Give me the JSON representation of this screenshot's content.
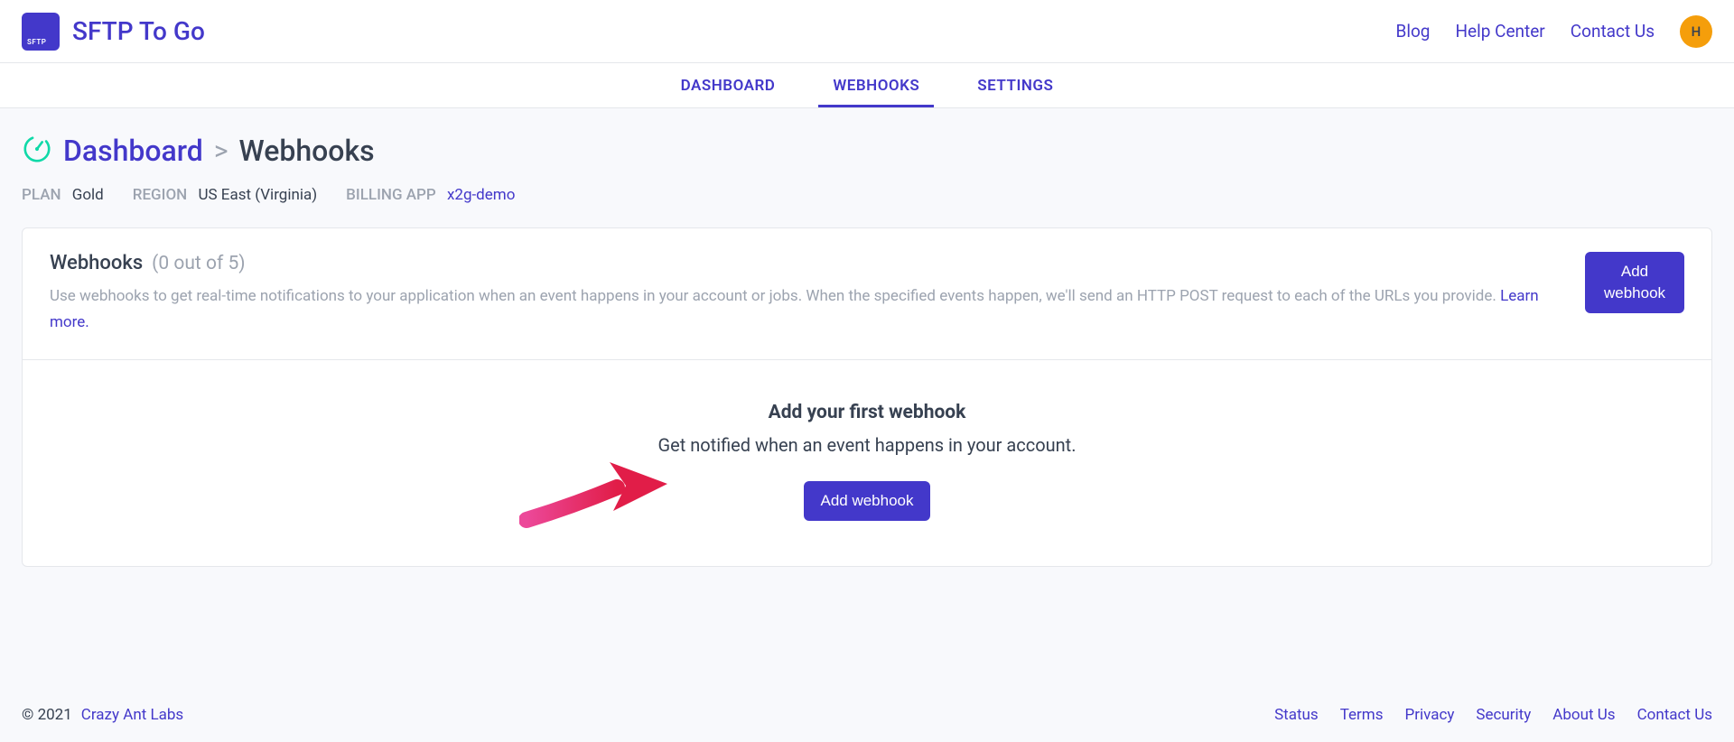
{
  "brand": {
    "name": "SFTP To Go",
    "logo_text": "SFTP"
  },
  "header": {
    "links": [
      "Blog",
      "Help Center",
      "Contact Us"
    ],
    "avatar_letter": "H"
  },
  "tabs": [
    "DASHBOARD",
    "WEBHOOKS",
    "SETTINGS"
  ],
  "breadcrumb": {
    "root": "Dashboard",
    "sep": ">",
    "current": "Webhooks"
  },
  "meta": {
    "plan_label": "PLAN",
    "plan_value": "Gold",
    "region_label": "REGION",
    "region_value": "US East (Virginia)",
    "billing_label": "BILLING APP",
    "billing_value": "x2g-demo"
  },
  "card": {
    "title": "Webhooks",
    "count": "(0 out of 5)",
    "desc": "Use webhooks to get real-time notifications to your application when an event happens in your account or jobs. When the specified events happen, we'll send an HTTP POST request to each of the URLs you provide.  ",
    "learn_more": "Learn more.",
    "add_btn": "Add webhook"
  },
  "empty": {
    "title": "Add your first webhook",
    "sub": "Get notified when an event happens in your account.",
    "btn": "Add webhook"
  },
  "footer": {
    "copyright": "© 2021 ",
    "company": "Crazy Ant Labs",
    "links": [
      "Status",
      "Terms",
      "Privacy",
      "Security",
      "About Us",
      "Contact Us"
    ]
  }
}
